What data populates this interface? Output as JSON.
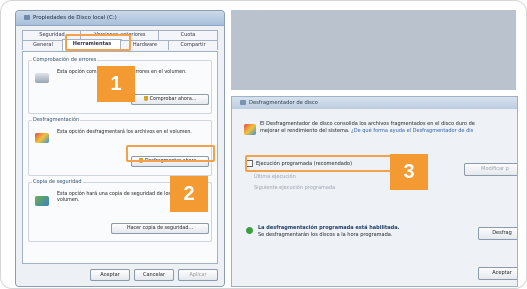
{
  "colors": {
    "accent": "#f39a32",
    "link": "#2b5fa8",
    "ok": "#3aa13a"
  },
  "props_window": {
    "title": "Propiedades de Disco local (C:)",
    "tabs_row1": [
      "Seguridad",
      "Versiones anteriores",
      "Cuota"
    ],
    "tabs_row2": [
      "General",
      "Herramientas",
      "Hardware",
      "Compartir"
    ],
    "active_tab": "Herramientas",
    "check_group": {
      "title": "Comprobación de errores",
      "text": "Esta opción comprobará si hay errores en el volumen.",
      "button": "Comprobar ahora..."
    },
    "defrag_group": {
      "title": "Desfragmentación",
      "text": "Esta opción desfragmentará los archivos en el volumen.",
      "button": "Desfragmentar ahora..."
    },
    "backup_group": {
      "title": "Copia de seguridad",
      "text": "Esta opción hará una copia de seguridad de los archivos en el volumen.",
      "button": "Hacer copia de seguridad..."
    },
    "buttons": {
      "accept": "Aceptar",
      "cancel": "Cancelar",
      "apply": "Aplicar"
    }
  },
  "defrag_window": {
    "title": "Desfragmentador de disco",
    "intro_line1": "El Desfragmentador de disco consolida los archivos fragmentados en el disco duro de",
    "intro_line2": "mejorar el rendimiento del sistema.",
    "intro_link": "¿De qué forma ayuda el Desfragmentador de dis",
    "schedule_checkbox": "Ejecución programada (recomendado)",
    "schedule_checked": false,
    "modify_button": "Modificar p",
    "last_run": "Última ejecución",
    "next_run": "Siguiente ejecución programada",
    "status_title": "La desfragmentación programada está habilitada.",
    "status_text": "Se desfragmentarán los discos a la hora programada.",
    "defrag_button": "Desfrag",
    "accept_button": "Aceptar"
  },
  "callouts": [
    "1",
    "2",
    "3"
  ]
}
